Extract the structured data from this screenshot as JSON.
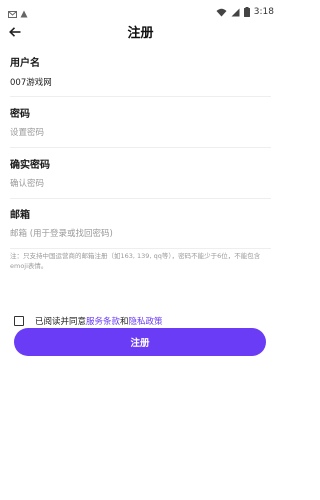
{
  "status_bar": {
    "time": "3:18",
    "icons": [
      "mail-icon",
      "notification-icon",
      "wifi-icon",
      "signal-icon",
      "battery-icon"
    ]
  },
  "header": {
    "title": "注册",
    "back_icon": "back-arrow-icon"
  },
  "form": {
    "username": {
      "label": "用户名",
      "value": "007游戏网",
      "placeholder": ""
    },
    "password": {
      "label": "密码",
      "value": "",
      "placeholder": "设置密码"
    },
    "confirm_password": {
      "label": "确实密码",
      "value": "",
      "placeholder": "确认密码"
    },
    "email": {
      "label": "邮箱",
      "value": "",
      "placeholder": "邮箱 (用于登录或找回密码)"
    }
  },
  "note": "注：只支持中国运营商的邮箱注册（如163, 139, qq等），密码不能少于6位，不能包含emoji表情。",
  "agreement": {
    "checked": false,
    "prefix": "已阅读并同意",
    "terms_link": "服务条款",
    "and": "和",
    "privacy_link": "隐私政策"
  },
  "submit": {
    "label": "注册"
  },
  "colors": {
    "accent": "#6b3cf6",
    "divider": "#eeeeee",
    "placeholder": "#9a9a9a"
  }
}
